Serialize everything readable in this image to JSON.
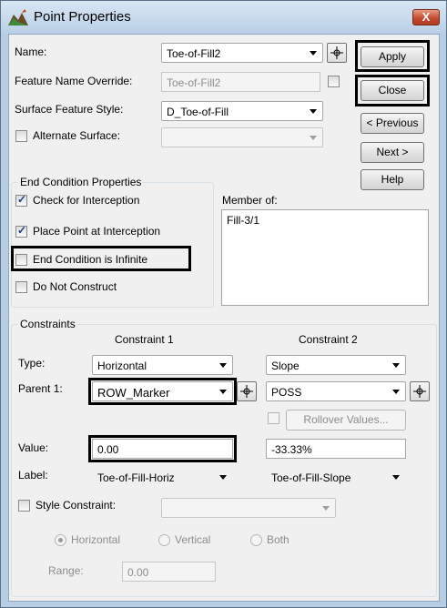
{
  "window": {
    "title": "Point Properties",
    "close_glyph": "X"
  },
  "top": {
    "name_label": "Name:",
    "name_value": "Toe-of-Fill2",
    "override_label": "Feature Name Override:",
    "override_value": "Toe-of-Fill2",
    "style_label": "Surface Feature Style:",
    "style_value": "D_Toe-of-Fill",
    "alt_surface_label": "Alternate Surface:",
    "alt_surface_value": ""
  },
  "buttons": {
    "apply": "Apply",
    "close": "Close",
    "previous": "< Previous",
    "next": "Next >",
    "help": "Help"
  },
  "end_condition": {
    "title": "End Condition Properties",
    "check_interception": "Check for Interception",
    "place_point": "Place Point at Interception",
    "infinite": "End Condition is Infinite",
    "do_not_construct": "Do Not Construct",
    "member_of_label": "Member of:",
    "member_of_items": [
      "Fill-3/1"
    ]
  },
  "constraints": {
    "title": "Constraints",
    "col1_header": "Constraint 1",
    "col2_header": "Constraint 2",
    "type_label": "Type:",
    "type1": "Horizontal",
    "type2": "Slope",
    "parent_label": "Parent 1:",
    "parent1": "ROW_Marker",
    "parent2": "POSS",
    "rollover_label": "Rollover Values...",
    "value_label": "Value:",
    "value1": "0.00",
    "value2": "-33.33%",
    "label_label": "Label:",
    "label1": "Toe-of-Fill-Horiz",
    "label2": "Toe-of-Fill-Slope",
    "style_constraint_label": "Style Constraint:",
    "style_constraint_value": "",
    "radio_horizontal": "Horizontal",
    "radio_vertical": "Vertical",
    "radio_both": "Both",
    "range_label": "Range:",
    "range_value": "0.00"
  },
  "colors": {
    "highlight": "#000000",
    "titlebar": "#c5d8ec",
    "close_button": "#c2472b",
    "check": "#1d3f87"
  }
}
